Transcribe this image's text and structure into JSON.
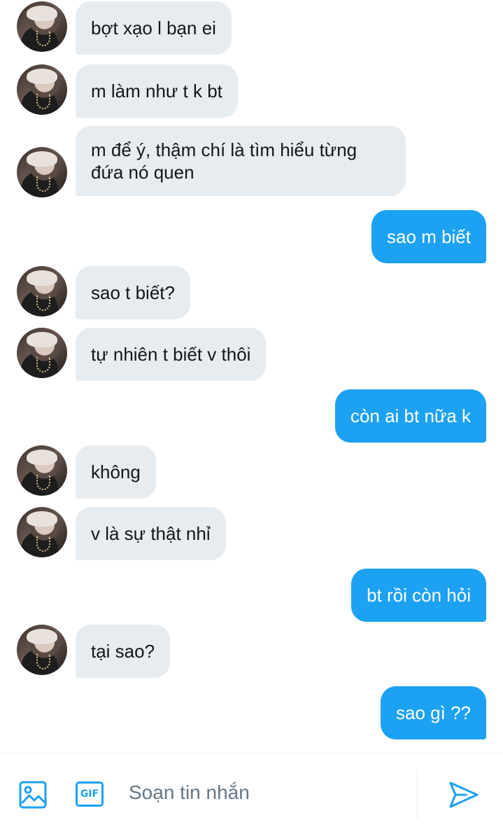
{
  "messages": [
    {
      "from": "them",
      "text": "bợt xạo l bạn ei"
    },
    {
      "from": "them",
      "text": "m làm như t k bt"
    },
    {
      "from": "them",
      "text": "m để ý, thậm chí là tìm hiểu từng đứa nó quen"
    },
    {
      "from": "me",
      "text": "sao m biết"
    },
    {
      "from": "them",
      "text": "sao t biết?"
    },
    {
      "from": "them",
      "text": "tự nhiên t biết v thôi"
    },
    {
      "from": "me",
      "text": "còn ai bt nữa k"
    },
    {
      "from": "them",
      "text": "không"
    },
    {
      "from": "them",
      "text": "v là sự thật nhỉ"
    },
    {
      "from": "me",
      "text": "bt rồi còn hỏi"
    },
    {
      "from": "them",
      "text": "tại sao?"
    },
    {
      "from": "me",
      "text": "sao gì ??"
    }
  ],
  "composer": {
    "placeholder": "Soạn tin nhắn",
    "gif_label": "GIF",
    "icons": [
      "image-icon",
      "gif-icon",
      "send-icon"
    ]
  },
  "colors": {
    "accent": "#1da1f2",
    "incoming_bubble": "#e6ecf0",
    "text": "#14171a",
    "placeholder": "#657786"
  }
}
